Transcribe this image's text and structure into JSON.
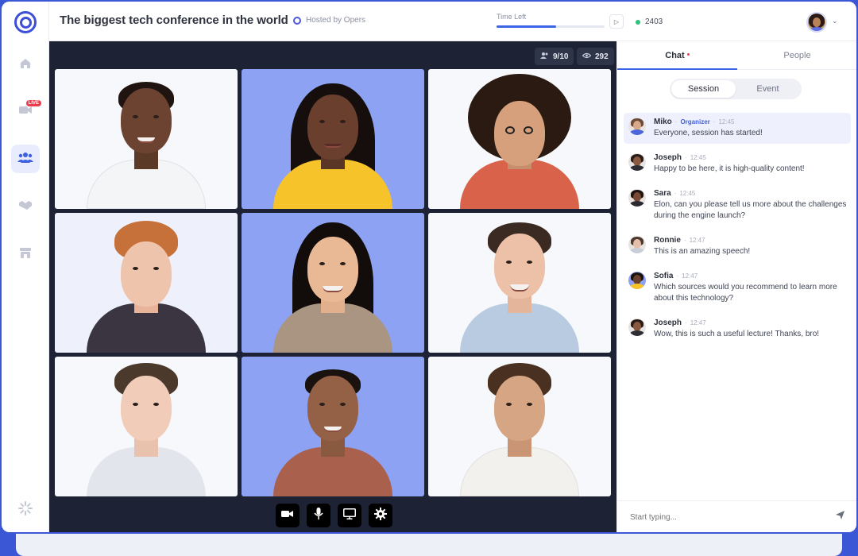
{
  "header": {
    "title": "The biggest tech conference in the world",
    "hosted_by": "Hosted by Opers",
    "time_left_label": "Time Left",
    "time_left_fraction": 0.55,
    "viewer_count": "2403"
  },
  "sidebar": {
    "live_badge": "LIVE",
    "items": [
      {
        "icon": "home-icon"
      },
      {
        "icon": "video-camera-icon"
      },
      {
        "icon": "people-group-icon"
      },
      {
        "icon": "handshake-icon"
      },
      {
        "icon": "booth-icon"
      }
    ],
    "footer_icon": "loading-spinner-icon"
  },
  "stage": {
    "participants_count": "9/10",
    "viewers_count": "292"
  },
  "controls": [
    "camera-icon",
    "microphone-icon",
    "screen-share-icon",
    "settings-icon"
  ],
  "panel": {
    "tabs": [
      {
        "label": "Chat"
      },
      {
        "label": "People"
      }
    ],
    "segments": [
      {
        "label": "Session"
      },
      {
        "label": "Event"
      }
    ],
    "messages": [
      {
        "name": "Miko",
        "role": "Organizer",
        "time": "12:45",
        "text": "Everyone, session has started!"
      },
      {
        "name": "Joseph",
        "role": "",
        "time": "12:45",
        "text": "Happy to be here, it is high-quality content!"
      },
      {
        "name": "Sara",
        "role": "",
        "time": "12:45",
        "text": "Elon, can you please tell us more about the challenges during the engine launch?"
      },
      {
        "name": "Ronnie",
        "role": "",
        "time": "12:47",
        "text": "This is an amazing speech!"
      },
      {
        "name": "Sofia",
        "role": "",
        "time": "12:47",
        "text": "Which sources would you recommend to learn more about this technology?"
      },
      {
        "name": "Joseph",
        "role": "",
        "time": "12:47",
        "text": "Wow, this is such a useful lecture! Thanks, bro!"
      }
    ],
    "composer_placeholder": "Start typing..."
  },
  "colors": {
    "accent": "#3d63e6",
    "brand": "#3d4fd8",
    "stage_background": "#1d2235",
    "live_red": "#ee3b4b",
    "online_green": "#2fc37a"
  }
}
